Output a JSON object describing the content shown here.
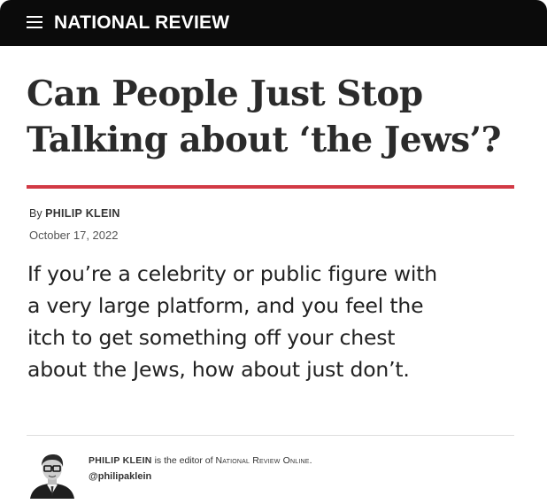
{
  "header": {
    "brand": "NATIONAL REVIEW",
    "menu_icon": "hamburger-menu-icon",
    "background": "#0b0b0b"
  },
  "article": {
    "headline_line1": "Can People Just Stop",
    "headline_line2": "Talking about ‘the Jews’?",
    "rule_color": "#d23a45",
    "byline_prefix": "By ",
    "author": "PHILIP KLEIN",
    "date": "October 17, 2022",
    "dek_line1": "If you’re a celebrity or public figure with",
    "dek_line2": "a very large platform, and you feel the",
    "dek_line3": "itch to get something off your chest",
    "dek_line4": "about the Jews, how about just don’t."
  },
  "author_box": {
    "name": "PHILIP KLEIN",
    "bio_text": " is the editor of ",
    "publication": "National Review Online",
    "bio_end": ".",
    "handle": "@philipaklein"
  }
}
